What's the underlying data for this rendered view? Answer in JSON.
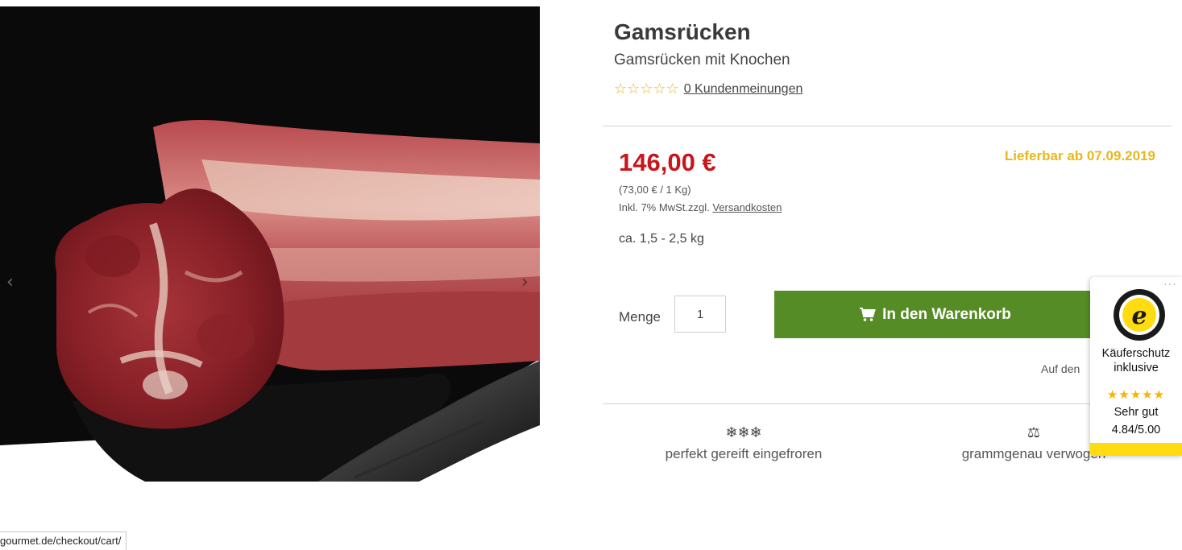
{
  "product": {
    "title": "Gamsrücken",
    "subtitle": "Gamsrücken mit Knochen",
    "rating_stars": "☆☆☆☆☆",
    "review_link": "0 Kundenmeinungen",
    "price": "146,00 €",
    "unit_price": "(73,00 € / 1 Kg)",
    "tax_text": "Inkl. 7% MwSt.zzgl.",
    "shipping_link": "Versandkosten",
    "weight": "ca. 1,5 - 2,5 kg",
    "availability": "Lieferbar ab 07.09.2019"
  },
  "carousel": {
    "prev_icon": "‹",
    "next_icon": "›"
  },
  "purchase": {
    "quantity_label": "Menge",
    "quantity_value": "1",
    "cart_button": "In den Warenkorb",
    "wishlist_partial": "Auf den"
  },
  "features": [
    {
      "icon": "❄❄❄",
      "text": "perfekt gereift eingefroren"
    },
    {
      "icon": "⚖",
      "text": "grammgenau verwogen"
    }
  ],
  "trusted_shops": {
    "menu_dots": "···",
    "seal_letter": "e",
    "protection_line1": "Käuferschutz",
    "protection_line2": "inklusive",
    "stars": "★★★★★",
    "grade": "Sehr gut",
    "score": "4.84/5.00"
  },
  "status_bar": {
    "url": "gourmet.de/checkout/cart/"
  },
  "colors": {
    "price_red": "#c8151b",
    "availability_yellow": "#e8b71d",
    "cart_green": "#568c25",
    "badge_yellow": "#ffdc0f"
  }
}
